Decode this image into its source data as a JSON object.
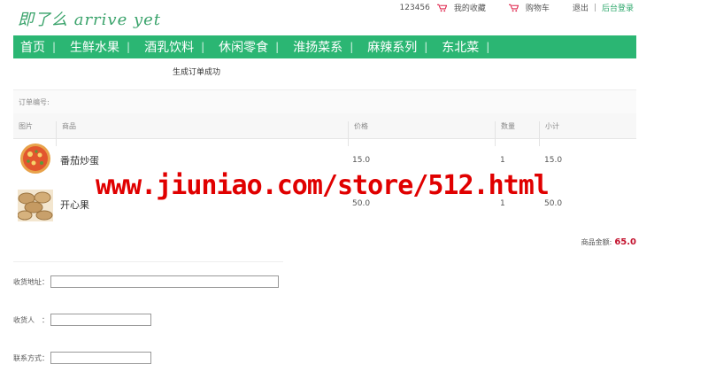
{
  "logo": {
    "text": "即了么 arrive  yet"
  },
  "topbar": {
    "username": "123456",
    "favorites": "我的收藏",
    "cart": "购物车",
    "logout": "退出",
    "separator": "|",
    "admin_login": "后台登录"
  },
  "nav": {
    "items": [
      "首页",
      "生鲜水果",
      "酒乳饮料",
      "休闲零食",
      "淮扬菜系",
      "麻辣系列",
      "东北菜"
    ]
  },
  "order": {
    "success_message": "生成订单成功",
    "order_number_label": "订单编号:"
  },
  "table": {
    "headers": {
      "image": "图片",
      "product": "商品",
      "price": "价格",
      "quantity": "数量",
      "subtotal": "小计"
    },
    "rows": [
      {
        "name": "番茄炒蛋",
        "price": "15.0",
        "quantity": "1",
        "subtotal": "15.0",
        "image": "pizza-image"
      },
      {
        "name": "开心果",
        "price": "50.0",
        "quantity": "1",
        "subtotal": "50.0",
        "image": "pistachio-image"
      }
    ]
  },
  "summary": {
    "label": "商品金额:",
    "amount": "65.0"
  },
  "form": {
    "address_label": "收货地址：",
    "address_value": "",
    "receiver_label": "收货人　：",
    "receiver_value": "",
    "contact_label": "联系方式：",
    "contact_value": ""
  },
  "watermark": {
    "text": "www.jiuniao.com/store/512.html"
  },
  "colors": {
    "nav_bg": "#2bb673",
    "accent": "#2fa86c",
    "price_red": "#c3122e",
    "watermark": "#e00000"
  }
}
